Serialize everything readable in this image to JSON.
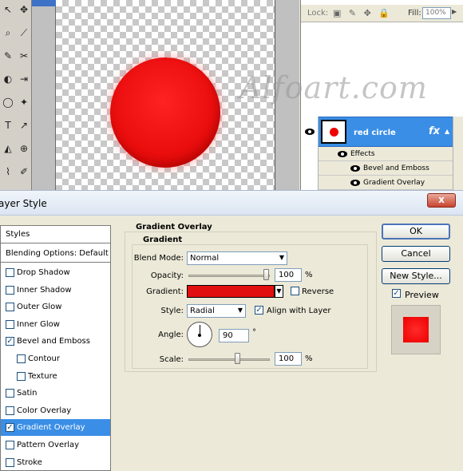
{
  "toolbox": {
    "glyphs": [
      "↖",
      "✥",
      "⌕",
      "⟋",
      "✎",
      "✂",
      "◐",
      "⇥",
      "◯",
      "✦",
      "T",
      "↗",
      "◭",
      "⊕",
      "⌇",
      "✐"
    ]
  },
  "layers_panel": {
    "lock_label": "Lock:",
    "lock_icons": "▣ ✎ ✥ 🔒",
    "fill_label": "Fill:",
    "fill_value": "100%",
    "layer_name": "red circle",
    "fx_label": "fx",
    "effects_label": "Effects",
    "effects": [
      "Bevel and Emboss",
      "Gradient Overlay"
    ]
  },
  "watermark": "Alfoart.com",
  "dialog": {
    "title": "ayer Style",
    "close_label": "x",
    "styles_header": "Styles",
    "blending_options": "Blending Options: Default",
    "style_list": [
      {
        "label": "Drop Shadow",
        "checked": false,
        "indent": false
      },
      {
        "label": "Inner Shadow",
        "checked": false,
        "indent": false
      },
      {
        "label": "Outer Glow",
        "checked": false,
        "indent": false
      },
      {
        "label": "Inner Glow",
        "checked": false,
        "indent": false
      },
      {
        "label": "Bevel and Emboss",
        "checked": true,
        "indent": false
      },
      {
        "label": "Contour",
        "checked": false,
        "indent": true
      },
      {
        "label": "Texture",
        "checked": false,
        "indent": true
      },
      {
        "label": "Satin",
        "checked": false,
        "indent": false
      },
      {
        "label": "Color Overlay",
        "checked": false,
        "indent": false
      },
      {
        "label": "Gradient Overlay",
        "checked": true,
        "indent": false,
        "active": true
      },
      {
        "label": "Pattern Overlay",
        "checked": false,
        "indent": false
      },
      {
        "label": "Stroke",
        "checked": false,
        "indent": false
      }
    ],
    "section_title": "Gradient Overlay",
    "group_title": "Gradient",
    "blend_mode_label": "Blend Mode:",
    "blend_mode_value": "Normal",
    "opacity_label": "Opacity:",
    "opacity_value": "100",
    "opacity_unit": "%",
    "gradient_label": "Gradient:",
    "gradient_color": "#e10f0f",
    "reverse_label": "Reverse",
    "style_label": "Style:",
    "style_value": "Radial",
    "align_label": "Align with Layer",
    "angle_label": "Angle:",
    "angle_value": "90",
    "angle_unit": "°",
    "scale_label": "Scale:",
    "scale_value": "100",
    "scale_unit": "%",
    "ok_label": "OK",
    "cancel_label": "Cancel",
    "new_style_label": "New Style...",
    "preview_label": "Preview"
  }
}
